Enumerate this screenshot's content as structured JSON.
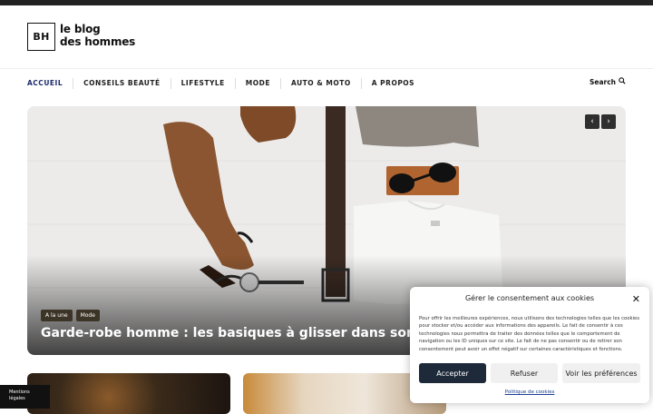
{
  "header": {
    "logo_abbr": "BH",
    "logo_line1": "le blog",
    "logo_line2": "des hommes"
  },
  "nav": {
    "items": [
      "ACCUEIL",
      "CONSEILS BEAUTÉ",
      "LIFESTYLE",
      "MODE",
      "AUTO & MOTO",
      "A PROPOS"
    ],
    "active": "ACCUEIL",
    "search_label": "Search",
    "search_icon": "search-icon"
  },
  "hero": {
    "tags": [
      "A la une",
      "Mode"
    ],
    "title": "Garde-robe homme : les basiques à glisser dans son arm",
    "prev_icon": "chevron-left-icon",
    "next_icon": "chevron-right-icon",
    "prev_glyph": "‹",
    "next_glyph": "›"
  },
  "footer": {
    "mentions_line1": "Mentions",
    "mentions_line2": "légales"
  },
  "cookie": {
    "title": "Gérer le consentement aux cookies",
    "close_glyph": "✕",
    "text": "Pour offrir les meilleures expériences, nous utilisons des technologies telles que les cookies pour stocker et/ou accéder aux informations des appareils. Le fait de consentir à ces technologies nous permettra de traiter des données telles que le comportement de navigation ou les ID uniques sur ce site. Le fait de ne pas consentir ou de retirer son consentement peut avoir un effet négatif sur certaines caractéristiques et fonctions.",
    "accept": "Accepter",
    "refuse": "Refuser",
    "prefs": "Voir les préférences",
    "policy": "Politique de cookies"
  }
}
